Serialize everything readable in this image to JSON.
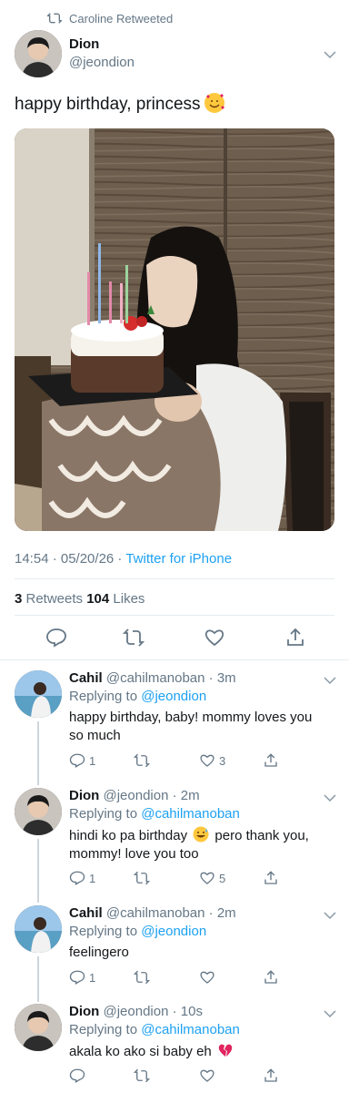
{
  "retweet_header": "Caroline Retweeted",
  "tweet": {
    "author_name": "Dion",
    "author_handle": "@jeondion",
    "text": "happy birthday, princess",
    "emoji": "smiling-face-with-hearts",
    "time": "14:54 · 05/20/26 · ",
    "source": "Twitter for iPhone",
    "retweets_count": "3",
    "retweets_label": " Retweets ",
    "likes_count": "104",
    "likes_label": " Likes"
  },
  "replies": [
    {
      "name": "Cahil",
      "handle": "@cahilmanoban",
      "time": " · 3m",
      "replying_label": "Replying to ",
      "replying_to": "@jeondion",
      "text": "happy birthday, baby! mommy loves you so much",
      "reply_count": "1",
      "like_count": "3"
    },
    {
      "name": "Dion",
      "handle": "@jeondion",
      "time": " · 2m",
      "replying_label": "Replying to ",
      "replying_to": "@cahilmanoban",
      "text_before": "hindi ko pa birthday ",
      "text_after": " pero thank you, mommy! love you too",
      "reply_count": "1",
      "like_count": "5"
    },
    {
      "name": "Cahil",
      "handle": "@cahilmanoban",
      "time": " · 2m",
      "replying_label": "Replying to ",
      "replying_to": "@jeondion",
      "text": "feelingero",
      "reply_count": "1",
      "like_count": ""
    },
    {
      "name": "Dion",
      "handle": "@jeondion",
      "time": " · 10s",
      "replying_label": "Replying to ",
      "replying_to": "@cahilmanoban",
      "text": "akala ko ako si baby eh",
      "reply_count": "",
      "like_count": ""
    }
  ],
  "colors": {
    "accent": "#1da1f2",
    "secondary_text": "#657786",
    "divider": "#e6ecf0"
  }
}
